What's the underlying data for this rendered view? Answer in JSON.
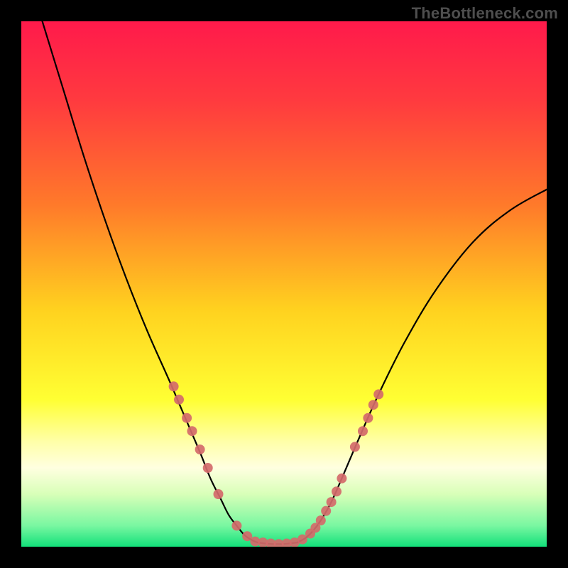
{
  "watermark": "TheBottleneck.com",
  "chart_data": {
    "type": "line",
    "title": "",
    "xlabel": "",
    "ylabel": "",
    "xlim": [
      0,
      100
    ],
    "ylim": [
      0,
      100
    ],
    "background_gradient": [
      {
        "pos": 0.0,
        "color": "#ff1a4b"
      },
      {
        "pos": 0.15,
        "color": "#ff3a3f"
      },
      {
        "pos": 0.35,
        "color": "#ff7a2a"
      },
      {
        "pos": 0.55,
        "color": "#ffd21f"
      },
      {
        "pos": 0.72,
        "color": "#ffff33"
      },
      {
        "pos": 0.8,
        "color": "#ffffa8"
      },
      {
        "pos": 0.85,
        "color": "#ffffe0"
      },
      {
        "pos": 0.9,
        "color": "#d8ffb8"
      },
      {
        "pos": 0.96,
        "color": "#79f7a1"
      },
      {
        "pos": 1.0,
        "color": "#12e07a"
      }
    ],
    "series": [
      {
        "name": "left-curve",
        "stroke": "#000000",
        "stroke_width": 2.2,
        "points": [
          [
            4,
            100
          ],
          [
            8,
            87
          ],
          [
            12,
            74
          ],
          [
            16,
            62
          ],
          [
            20,
            51
          ],
          [
            24,
            41
          ],
          [
            28,
            32
          ],
          [
            31,
            25
          ],
          [
            34,
            18
          ],
          [
            36,
            13
          ],
          [
            38,
            9
          ],
          [
            39.5,
            6
          ],
          [
            41,
            4
          ],
          [
            42.5,
            2.2
          ],
          [
            44,
            1.2
          ],
          [
            45,
            0.8
          ]
        ]
      },
      {
        "name": "valley-floor",
        "stroke": "#000000",
        "stroke_width": 2.2,
        "points": [
          [
            45,
            0.8
          ],
          [
            46.5,
            0.6
          ],
          [
            48,
            0.5
          ],
          [
            49.5,
            0.5
          ],
          [
            51,
            0.6
          ],
          [
            52.5,
            0.8
          ]
        ]
      },
      {
        "name": "right-curve",
        "stroke": "#000000",
        "stroke_width": 2.2,
        "points": [
          [
            52.5,
            0.8
          ],
          [
            54,
            1.6
          ],
          [
            55.5,
            3.0
          ],
          [
            57,
            5.0
          ],
          [
            59,
            8.5
          ],
          [
            61,
            13
          ],
          [
            64,
            20
          ],
          [
            68,
            29
          ],
          [
            73,
            39
          ],
          [
            79,
            49
          ],
          [
            86,
            58
          ],
          [
            93,
            64
          ],
          [
            100,
            68
          ]
        ]
      }
    ],
    "markers": {
      "color": "#d46a6a",
      "radius": 7,
      "points": [
        [
          29.0,
          30.5
        ],
        [
          30.0,
          28.0
        ],
        [
          31.5,
          24.5
        ],
        [
          32.5,
          22.0
        ],
        [
          34.0,
          18.5
        ],
        [
          35.5,
          15.0
        ],
        [
          37.5,
          10.0
        ],
        [
          41.0,
          4.0
        ],
        [
          43.0,
          2.0
        ],
        [
          44.5,
          1.0
        ],
        [
          46.0,
          0.8
        ],
        [
          47.5,
          0.6
        ],
        [
          49.0,
          0.5
        ],
        [
          50.5,
          0.6
        ],
        [
          52.0,
          0.8
        ],
        [
          53.5,
          1.4
        ],
        [
          55.0,
          2.5
        ],
        [
          56.0,
          3.6
        ],
        [
          57.0,
          5.0
        ],
        [
          58.0,
          6.8
        ],
        [
          59.0,
          8.5
        ],
        [
          60.0,
          10.5
        ],
        [
          61.0,
          13.0
        ],
        [
          63.5,
          19.0
        ],
        [
          65.0,
          22.0
        ],
        [
          66.0,
          24.5
        ],
        [
          67.0,
          27.0
        ],
        [
          68.0,
          29.0
        ]
      ]
    }
  }
}
